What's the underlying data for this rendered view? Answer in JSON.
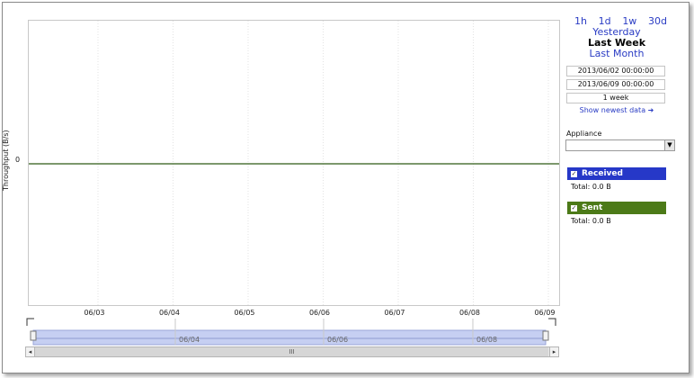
{
  "chart": {
    "y_axis_label": "Throughput (B/s)",
    "y_tick": "0",
    "x_ticks": [
      "06/03",
      "06/04",
      "06/05",
      "06/06",
      "06/07",
      "06/08",
      "06/09"
    ],
    "navigator_labels": [
      "06/04",
      "06/06",
      "06/08"
    ],
    "series_color": "#4e7a1d",
    "scroll_thumb": "III"
  },
  "chart_data": {
    "type": "line",
    "x": [
      "06/03",
      "06/04",
      "06/05",
      "06/06",
      "06/07",
      "06/08",
      "06/09"
    ],
    "series": [
      {
        "name": "Received",
        "values": [
          0,
          0,
          0,
          0,
          0,
          0,
          0
        ]
      },
      {
        "name": "Sent",
        "values": [
          0,
          0,
          0,
          0,
          0,
          0,
          0
        ]
      }
    ],
    "ylabel": "Throughput (B/s)",
    "grid": true
  },
  "time_ranges": {
    "quick": [
      "1h",
      "1d",
      "1w",
      "30d"
    ],
    "yesterday": "Yesterday",
    "last_week": "Last Week",
    "last_month": "Last Month",
    "start": "2013/06/02 00:00:00",
    "end": "2013/06/09 00:00:00",
    "duration": "1 week",
    "show_newest": "Show newest data ➜"
  },
  "appliance": {
    "label": "Appliance",
    "value": ""
  },
  "legend": {
    "received": {
      "label": "Received",
      "color": "#2638c8",
      "total": "Total: 0.0 B"
    },
    "sent": {
      "label": "Sent",
      "color": "#4c7a18",
      "total": "Total: 0.0 B"
    }
  },
  "colors": {
    "link": "#2a3cc4",
    "border": "#8a8a8a"
  }
}
